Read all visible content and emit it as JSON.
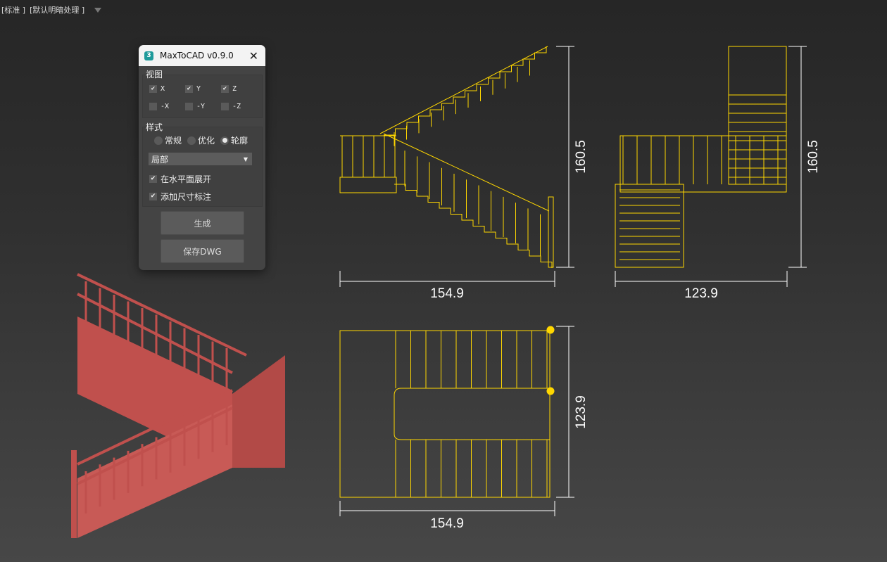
{
  "viewport": {
    "label_1": "[标准 ]",
    "label_2": "[默认明暗处理 ]"
  },
  "dialog": {
    "title": "MaxToCAD v0.9.0",
    "app_icon": "3",
    "view_group": "视图",
    "views": [
      {
        "label": "X",
        "checked": true
      },
      {
        "label": "Y",
        "checked": true
      },
      {
        "label": "Z",
        "checked": true
      },
      {
        "label": "-X",
        "checked": false
      },
      {
        "label": "-Y",
        "checked": false
      },
      {
        "label": "-Z",
        "checked": false
      }
    ],
    "style_group": "样式",
    "styles": [
      {
        "label": "常规",
        "selected": false
      },
      {
        "label": "优化",
        "selected": false
      },
      {
        "label": "轮廓",
        "selected": true
      }
    ],
    "scope_select": "局部",
    "expand_horizontal": {
      "label": "在水平面展开",
      "checked": true
    },
    "add_dimensions": {
      "label": "添加尺寸标注",
      "checked": true
    },
    "generate_button": "生成",
    "save_button": "保存DWG"
  },
  "drawings": {
    "side": {
      "width": "154.9",
      "height": "160.5"
    },
    "front": {
      "width": "123.9",
      "height": "160.5"
    },
    "top": {
      "width": "154.9",
      "height": "123.9"
    }
  },
  "colors": {
    "cad_line": "#ffd700",
    "model": "#c0504d"
  }
}
